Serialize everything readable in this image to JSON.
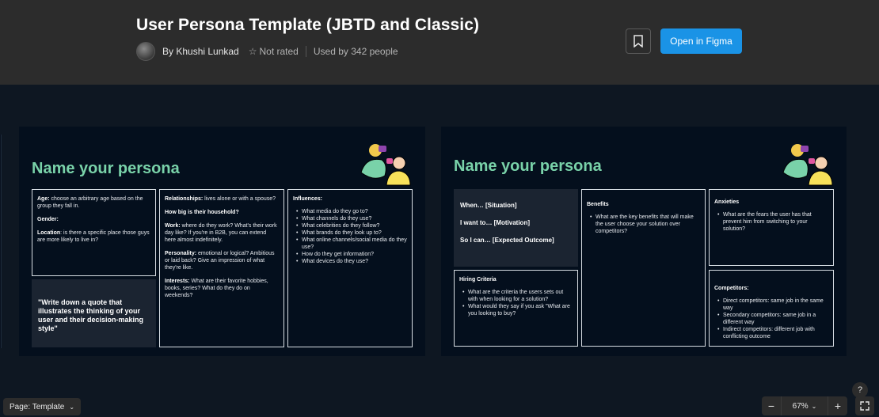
{
  "header": {
    "title": "User Persona Template (JBTD and Classic)",
    "author": "By Khushi Lunkad",
    "rating": "Not rated",
    "usage": "Used by 342 people",
    "open_label": "Open in Figma"
  },
  "colors": {
    "accent": "#1a93e6",
    "persona_title": "#79d2a9",
    "topbar": "#2c2c2c",
    "canvas": "#0e1722",
    "frame": "#040f1d"
  },
  "frame1": {
    "title": "Name your persona",
    "basics": {
      "age_label": "Age:",
      "age_text": " choose an arbitrary age based on the group they fall in.",
      "gender_label": "Gender:",
      "location_label": "Location",
      "location_text": ": is there a specific place those guys are more likely to live in?"
    },
    "quote": "\"Write down a quote that illustrates the thinking of your user and their decision-making style\"",
    "household": {
      "relationships_label": "Relationships:",
      "relationships_text": " lives alone or with a spouse?",
      "household_q": "How big is their household?",
      "work_label": "Work:",
      "work_text": " where do they work? What's their work day like? If you're in B2B, you can extend here almost indefinitely.",
      "personality_label": "Personality:",
      "personality_text": " emotional or logical? Ambitious or laid back? Give an impression of what they're like.",
      "interests_label": "Interests:",
      "interests_text": " What are their favorite hobbies, books, series? What do they do on weekends?"
    },
    "influences": {
      "title": "Influences:",
      "items": [
        "What media do they go to?",
        "What channels do they use?",
        "What celebrities do they follow?",
        "What brands do they look up to?",
        "What online channels/social media do they use?",
        "How do they get information?",
        "What devices do they use?"
      ]
    }
  },
  "frame2": {
    "title": "Name your persona",
    "jtbd": {
      "when": "When… [Situation]",
      "want": "I want to… [Motivation]",
      "can": "So I can… [Expected Outcome]"
    },
    "hiring": {
      "title": "Hiring Criteria",
      "items": [
        "What are the criteria the users sets out with when looking for a solution?",
        "What would they say if you ask \"What are you looking to buy?"
      ]
    },
    "benefits": {
      "title": "Benefits",
      "items": [
        "What are the key benefits that will make the user choose your solution over competitors?"
      ]
    },
    "anxieties": {
      "title": "Anxieties",
      "items": [
        "What are the fears the user has that prevent him from switching to your solution?"
      ]
    },
    "competitors": {
      "title": "Competitors:",
      "items": [
        "Direct competitors: same job in the same way",
        "Secondary competitors: same job in a different way",
        "Indirect competitors: different job with conflicting outcome"
      ]
    }
  },
  "footer": {
    "page_label": "Page: Template",
    "zoom": "67%",
    "help": "?"
  }
}
